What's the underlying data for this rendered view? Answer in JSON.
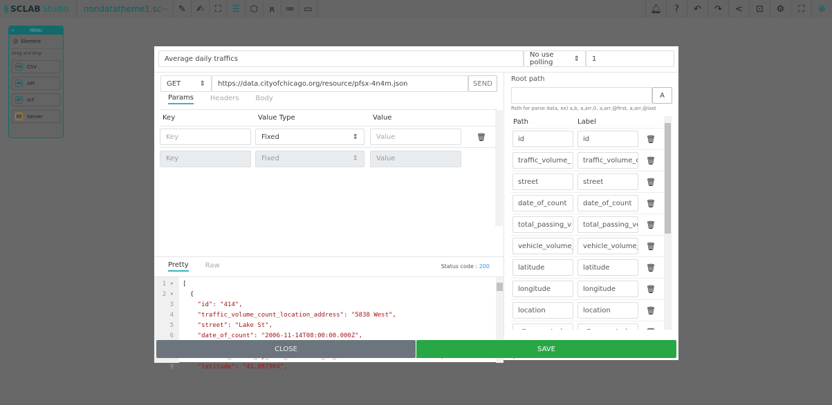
{
  "topbar": {
    "logo": "SCLAB",
    "logo_suffix": "Studio",
    "file_name": "nondatatheme1.sc···",
    "left_tools": [
      "edit-screen-icon",
      "edit-icon",
      "map-icon",
      "database-icon",
      "code-icon",
      "users-icon",
      "list-icon",
      "card-icon"
    ],
    "right_tools": [
      "bell-icon",
      "help-icon",
      "undo-icon",
      "redo-icon",
      "share-icon",
      "unlock-icon",
      "gear-icon",
      "fullscreen-icon",
      "upload-icon"
    ]
  },
  "menu": {
    "title": "MENU",
    "element": "Element",
    "drag_hint": "Drag and drop",
    "items": [
      {
        "label": "CSV",
        "icon": "CSV"
      },
      {
        "label": "API",
        "icon": "API"
      },
      {
        "label": "IoT",
        "icon": "IOT"
      },
      {
        "label": "Server",
        "icon": "SRV"
      }
    ]
  },
  "modal": {
    "title": "Average daily traffics",
    "polling": "No use polling",
    "polling_value": "1",
    "method": "GET",
    "url": "https://data.cityofchicago.org/resource/pfsx-4n4m.json",
    "send": "SEND",
    "req_tabs": [
      "Params",
      "Headers",
      "Body"
    ],
    "params_headers": [
      "Key",
      "Value Type",
      "Value"
    ],
    "params": [
      {
        "key_ph": "Key",
        "type": "Fixed",
        "value_ph": "Value"
      },
      {
        "key_ph": "Key",
        "type": "Fixed",
        "value_ph": "Value"
      }
    ],
    "resp_tabs": [
      "Pretty",
      "Raw"
    ],
    "status_label": "Status code :",
    "status_code": "200",
    "code_lines": [
      "[",
      "  {",
      "    \"id\": \"414\",",
      "    \"traffic_volume_count_location_address\": \"5838 West\",",
      "    \"street\": \"Lake St\",",
      "    \"date_of_count\": \"2006-11-14T08:00:00.000Z\",",
      "    \"total_passing_vehicle_volume\": \"7100\",",
      "    \"vehicle_volume_by_each_direction_of_traffic\": \"East Bound: 3600 / West Bound: 3500\",",
      "    \"latitude\": \"41.887904\","
    ],
    "root_path_label": "Root path",
    "root_path_value": "",
    "root_hint": "Path for parse data, ex) a,b, a,arr,0, a,arr,@first, a,arr,@last",
    "path_headers": [
      "Path",
      "Label"
    ],
    "paths": [
      {
        "path": "id",
        "label": "id"
      },
      {
        "path": "traffic_volume_",
        "label": "traffic_volume_c"
      },
      {
        "path": "street",
        "label": "street"
      },
      {
        "path": "date_of_count",
        "label": "date_of_count"
      },
      {
        "path": "total_passing_v",
        "label": "total_passing_ve"
      },
      {
        "path": "vehicle_volume_",
        "label": "vehicle_volume_"
      },
      {
        "path": "latitude",
        "label": "latitude"
      },
      {
        "path": "longitude",
        "label": "longitude"
      },
      {
        "path": "location",
        "label": "location"
      },
      {
        "path": ":@computed_",
        "label": ":@computed_"
      }
    ],
    "close": "CLOSE",
    "save": "SAVE"
  },
  "colors": {
    "accent": "#136a6a",
    "save": "#28a745",
    "close": "#6c757d",
    "tab_underline": "#3cb4c4",
    "status": "#3b8ee8"
  }
}
